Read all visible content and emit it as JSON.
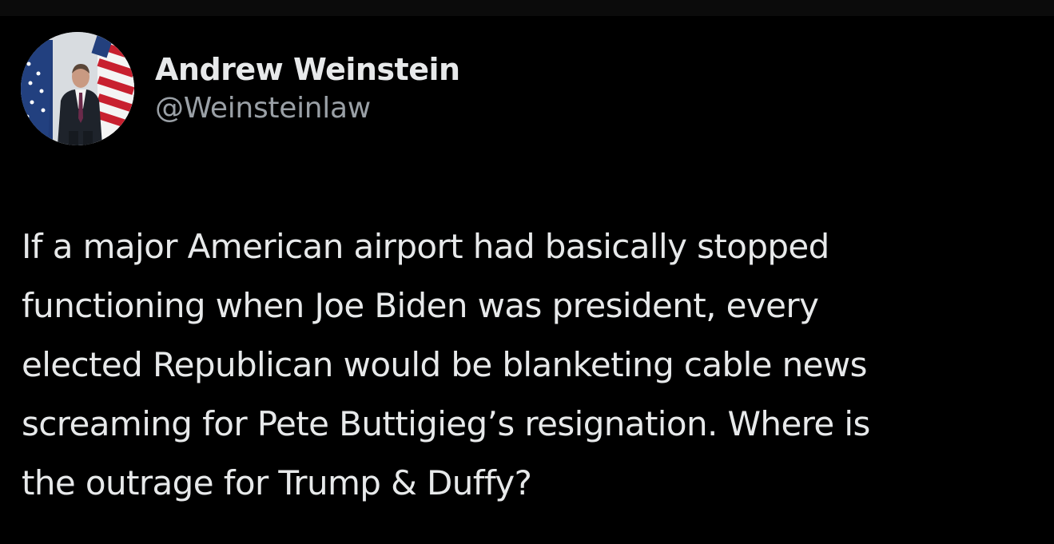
{
  "author": {
    "display_name": "Andrew Weinstein",
    "handle": "@Weinsteinlaw"
  },
  "tweet": {
    "text": "If a major American airport had basically stopped\nfunctioning when Joe Biden was president, every\nelected Republican would be blanketing cable news\nscreaming for Pete Buttigieg’s resignation. Where is\nthe outrage for Trump & Duffy?"
  },
  "colors": {
    "background": "#000000",
    "primary_text": "#e7e9ea",
    "secondary_text": "#9aa0a6"
  }
}
